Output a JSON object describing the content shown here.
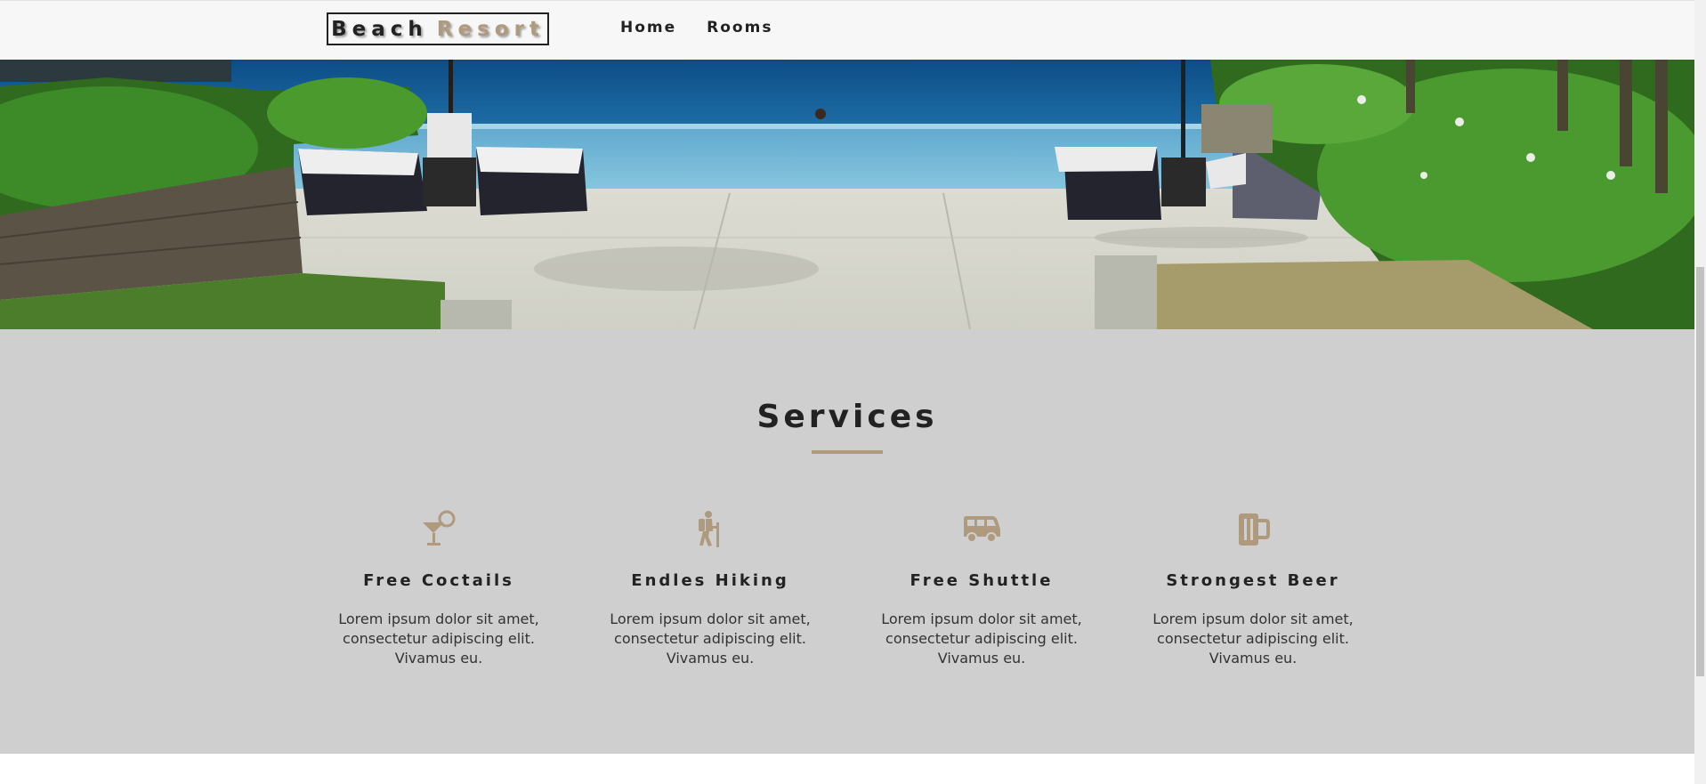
{
  "navbar": {
    "logo_word1": "Beach",
    "logo_word2": "Resort",
    "links": [
      {
        "label": "Home"
      },
      {
        "label": "Rooms"
      }
    ]
  },
  "services": {
    "title": "Services",
    "items": [
      {
        "icon": "cocktail-icon",
        "title": "Free Coctails",
        "text": "Lorem ipsum dolor sit amet, consectetur adipiscing elit. Vivamus eu."
      },
      {
        "icon": "hiking-icon",
        "title": "Endles Hiking",
        "text": "Lorem ipsum dolor sit amet, consectetur adipiscing elit. Vivamus eu."
      },
      {
        "icon": "shuttle-van-icon",
        "title": "Free Shuttle",
        "text": "Lorem ipsum dolor sit amet, consectetur adipiscing elit. Vivamus eu."
      },
      {
        "icon": "beer-mug-icon",
        "title": "Strongest Beer",
        "text": "Lorem ipsum dolor sit amet, consectetur adipiscing elit. Vivamus eu."
      }
    ]
  },
  "colors": {
    "accent": "#af9a7d",
    "text_dark": "#222222",
    "services_bg": "#cfcfcf",
    "navbar_bg": "#f7f7f7"
  }
}
